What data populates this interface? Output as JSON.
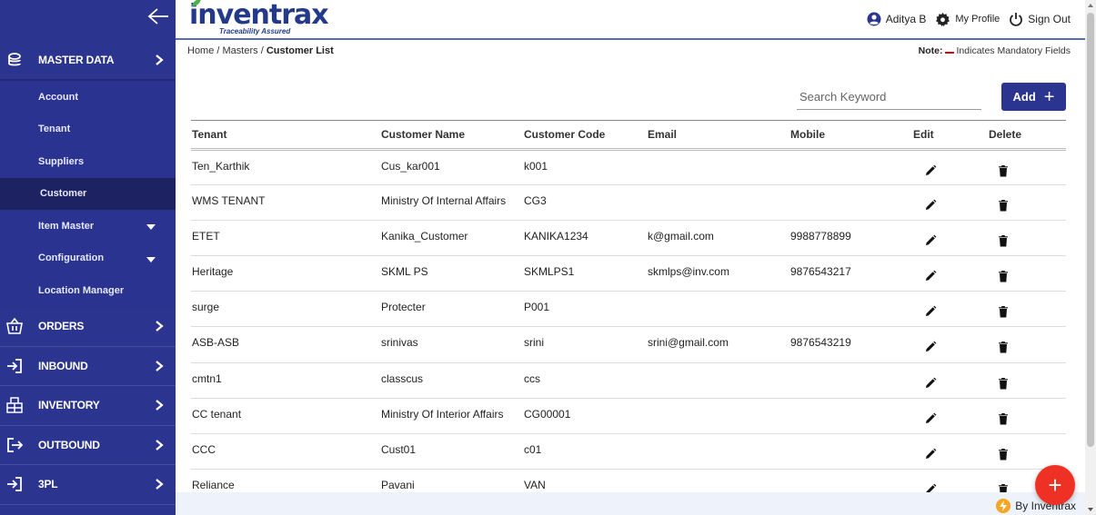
{
  "sidebar": {
    "main": [
      {
        "label": "MASTER DATA",
        "icon": "database-icon"
      },
      {
        "label": "ORDERS",
        "icon": "basket-icon"
      },
      {
        "label": "INBOUND",
        "icon": "inbound-icon"
      },
      {
        "label": "INVENTORY",
        "icon": "inventory-icon"
      },
      {
        "label": "OUTBOUND",
        "icon": "outbound-icon"
      },
      {
        "label": "3PL",
        "icon": "threepl-icon"
      }
    ],
    "sub": [
      {
        "label": "Account"
      },
      {
        "label": "Tenant"
      },
      {
        "label": "Suppliers"
      },
      {
        "label": "Customer"
      },
      {
        "label": "Item Master"
      },
      {
        "label": "Configuration"
      },
      {
        "label": "Location Manager"
      }
    ]
  },
  "header": {
    "logo": "inventrax",
    "tagline": "Traceability Assured",
    "user": "Aditya B",
    "profile": "My Profile",
    "signout": "Sign Out"
  },
  "breadcrumb": {
    "home": "Home",
    "masters": "Masters",
    "current": "Customer List",
    "sep": " / "
  },
  "note": {
    "label": "Note:",
    "text": "Indicates Mandatory Fields"
  },
  "search": {
    "placeholder": "Search Keyword"
  },
  "add_button": {
    "label": "Add",
    "plus": "+"
  },
  "table": {
    "headers": [
      "Tenant",
      "Customer Name",
      "Customer Code",
      "Email",
      "Mobile",
      "Edit",
      "Delete"
    ],
    "rows": [
      [
        "Ten_Karthik",
        "Cus_kar001",
        "k001",
        "",
        ""
      ],
      [
        "WMS TENANT",
        "Ministry Of Internal Affairs",
        "CG3",
        "",
        ""
      ],
      [
        "ETET",
        "Kanika_Customer",
        "KANIKA1234",
        "k@gmail.com",
        "9988778899"
      ],
      [
        "Heritage",
        "SKML PS",
        "SKMLPS1",
        "skmlps@inv.com",
        "9876543217"
      ],
      [
        "surge",
        "Protecter",
        "P001",
        "",
        ""
      ],
      [
        "ASB-ASB",
        "srinivas",
        "srini",
        "srini@gmail.com",
        "9876543219"
      ],
      [
        "cmtn1",
        "classcus",
        "ccs",
        "",
        ""
      ],
      [
        "CC tenant",
        "Ministry Of Interior Affairs",
        "CG00001",
        "",
        ""
      ],
      [
        "CCC",
        "Cust01",
        "c01",
        "",
        ""
      ],
      [
        "Reliance",
        "Pavani",
        "VAN",
        "",
        ""
      ]
    ]
  },
  "footer": {
    "text": "By Inventrax"
  },
  "fab": {
    "label": "+"
  },
  "colors": {
    "sidebar": "#2b3590",
    "active": "#1d2262",
    "accent": "#ee3124"
  }
}
